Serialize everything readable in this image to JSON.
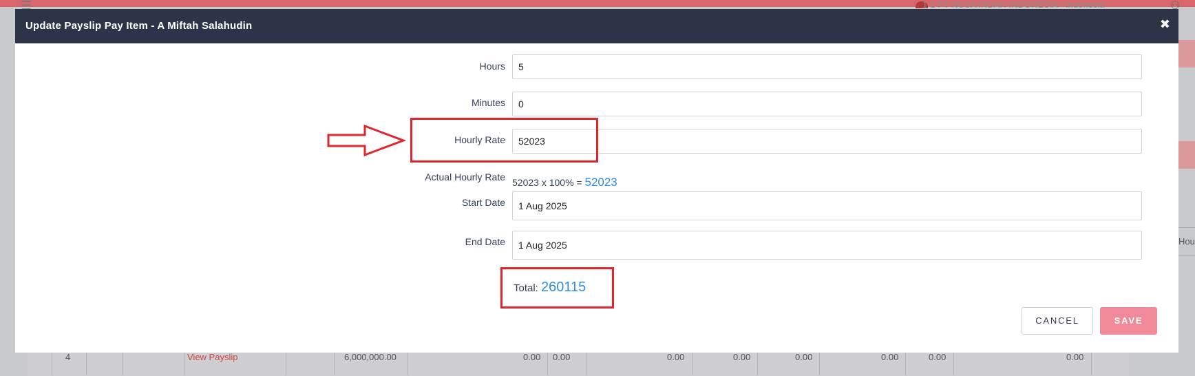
{
  "background": {
    "company_label": "1-1 PT NUSA INDAH INDONESIA • Indonesia",
    "side_text": "Hour",
    "row": {
      "number": "4",
      "link": "View Payslip",
      "amount": "6,000,000.00",
      "zero": "0.00"
    }
  },
  "modal": {
    "title": "Update Payslip Pay Item - A Miftah Salahudin",
    "close_icon": "close-icon",
    "fields": {
      "hours": {
        "label": "Hours",
        "value": "5"
      },
      "minutes": {
        "label": "Minutes",
        "value": "0"
      },
      "hourly_rate": {
        "label": "Hourly Rate",
        "value": "52023"
      },
      "actual_hourly_rate": {
        "label": "Actual Hourly Rate",
        "formula": "52023 x 100% =",
        "result": "52023"
      },
      "start_date": {
        "label": "Start Date",
        "value": "1 Aug 2025"
      },
      "end_date": {
        "label": "End Date",
        "value": "1 Aug 2025"
      }
    },
    "total": {
      "label": "Total:",
      "value": "260115"
    },
    "buttons": {
      "cancel": "CANCEL",
      "save": "SAVE"
    }
  },
  "colors": {
    "header_bg": "#2d3447",
    "accent_blue": "#2d8ee0",
    "save_button": "#f08a9a",
    "annotation_red": "#e0252f"
  }
}
